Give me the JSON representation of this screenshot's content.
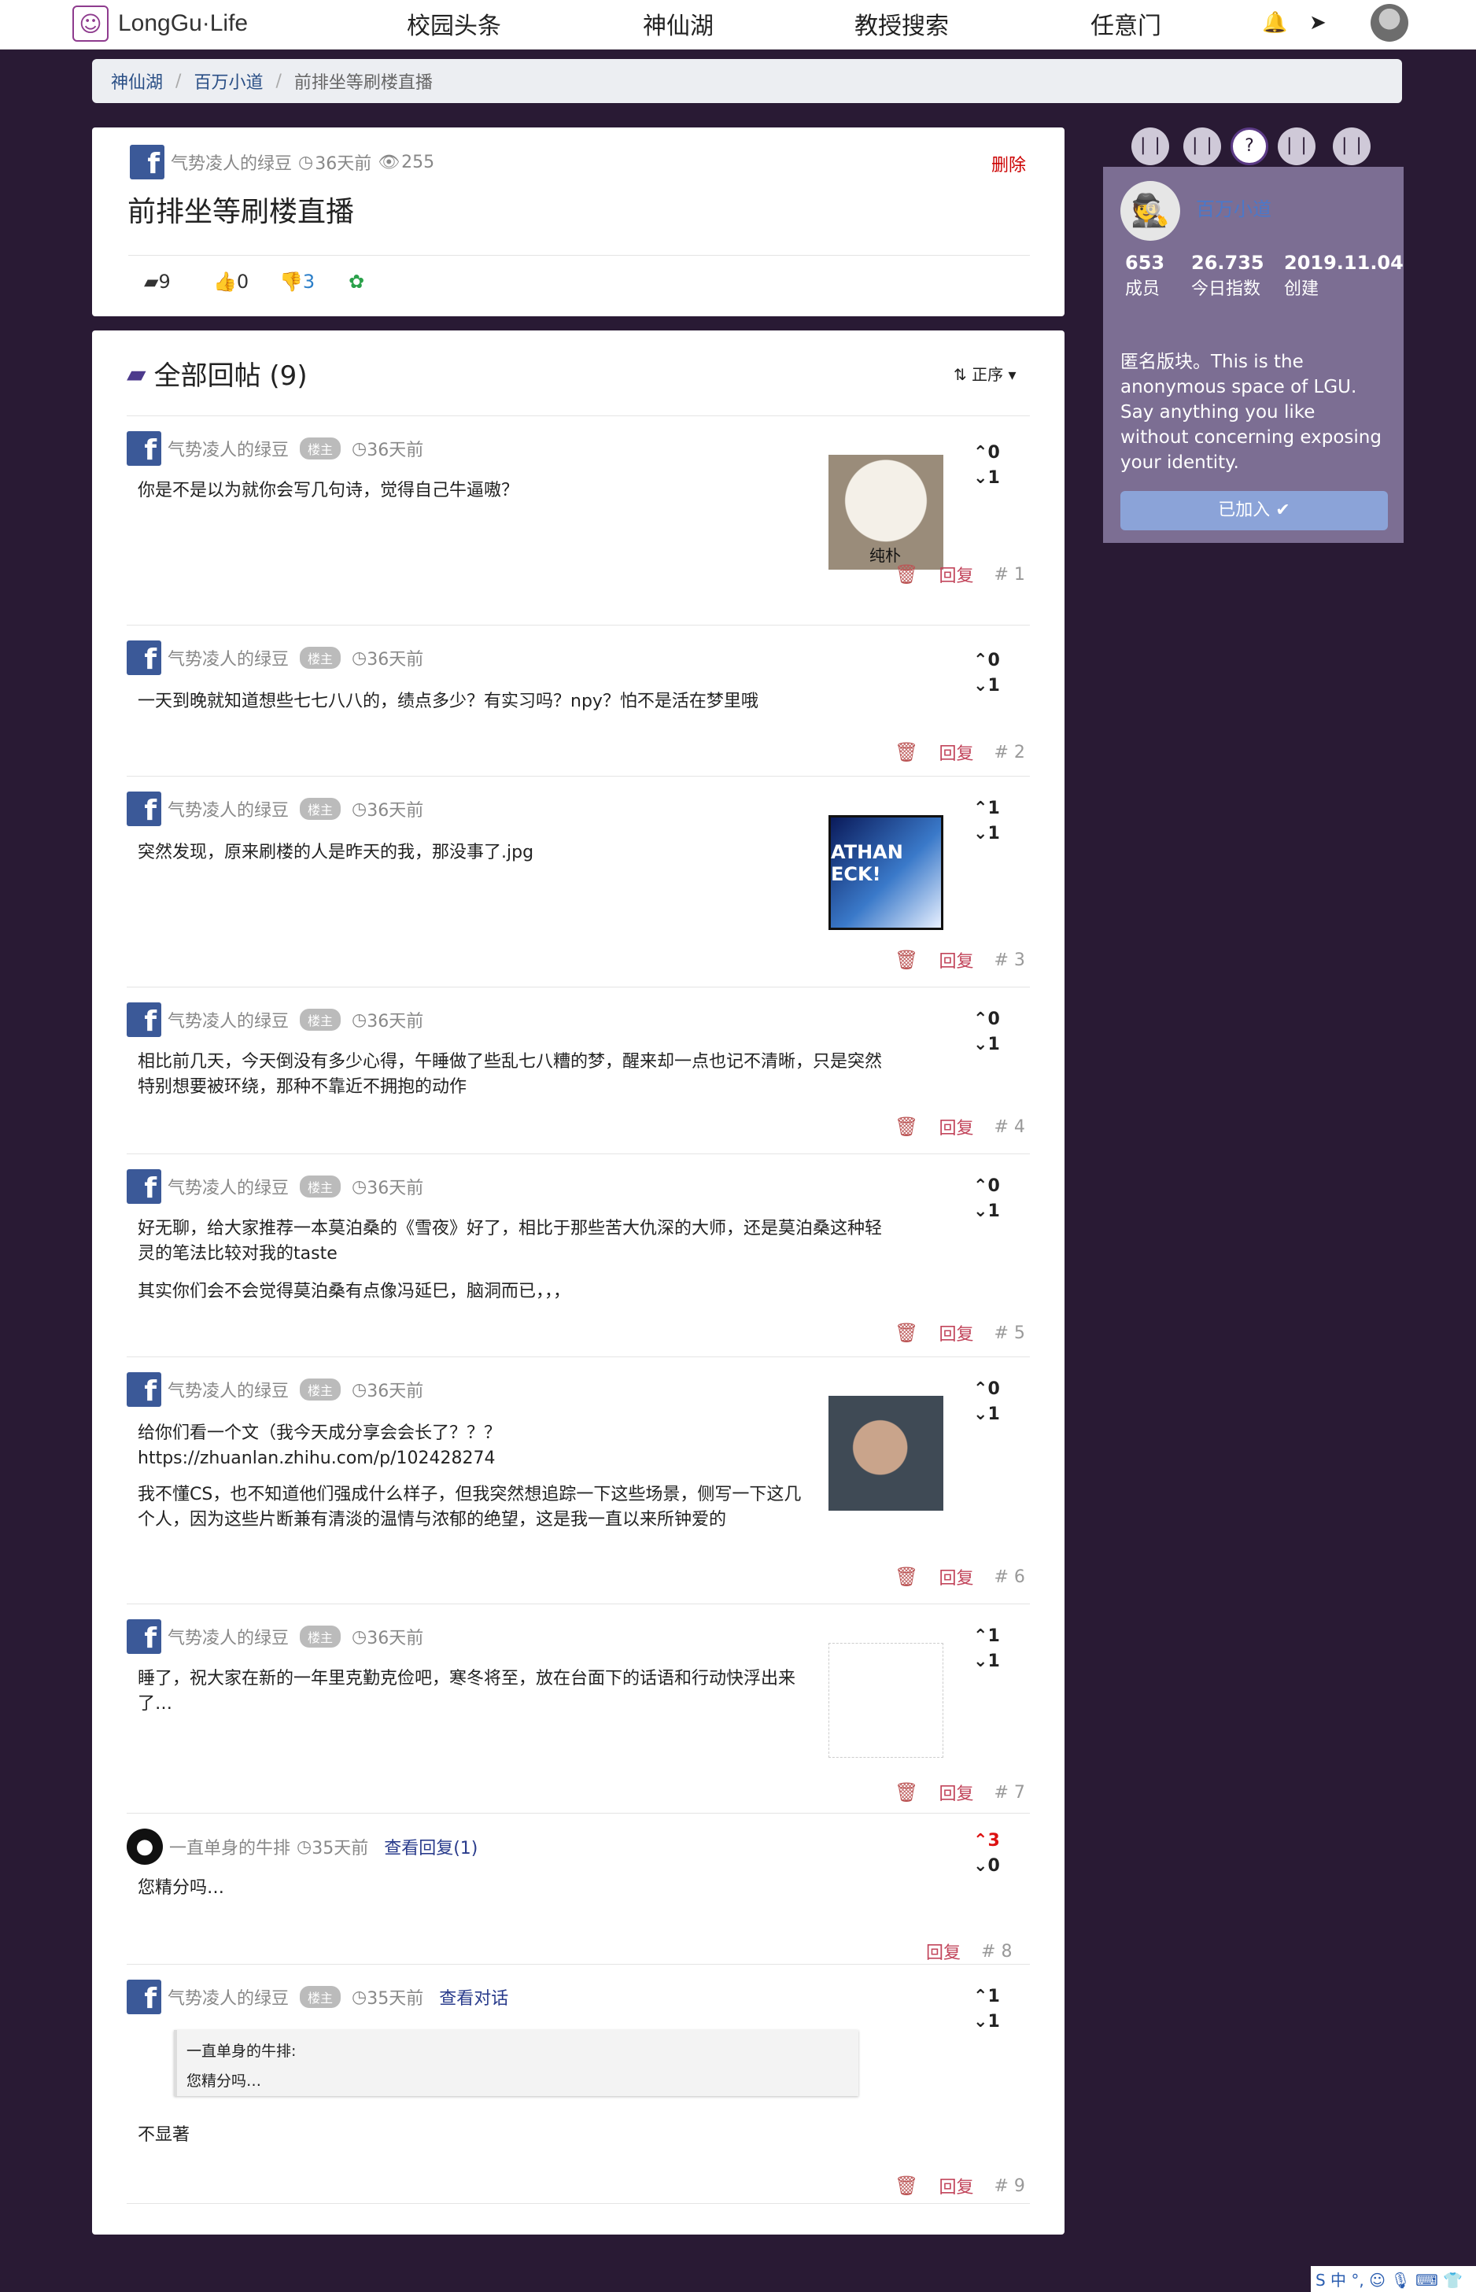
{
  "nav": {
    "brand": "LongGu·Life",
    "links": [
      "校园头条",
      "神仙湖",
      "教授搜索",
      "任意门"
    ]
  },
  "breadcrumb": [
    "神仙湖",
    "百万小道",
    "前排坐等刷楼直播"
  ],
  "post": {
    "author": "气势凌人的绿豆",
    "time": "36天前",
    "views": "255",
    "delete": "删除",
    "title": "前排坐等刷楼直播",
    "comments": "9",
    "likes": "0",
    "dislikes": "3"
  },
  "replies_header": {
    "title": "全部回帖 (9)",
    "sort": "正序"
  },
  "replies": [
    {
      "author": "气势凌人的绿豆",
      "badge": "楼主",
      "time": "36天前",
      "text": "你是不是以为就你会写几句诗，觉得自己牛逼嗷？",
      "up": "0",
      "down": "1",
      "reply": "回复",
      "floor": "# 1",
      "thumb_caption": "纯朴"
    },
    {
      "author": "气势凌人的绿豆",
      "badge": "楼主",
      "time": "36天前",
      "text": "一天到晚就知道想些七七八八的，绩点多少？有实习吗？npy？怕不是活在梦里哦",
      "up": "0",
      "down": "1",
      "reply": "回复",
      "floor": "# 2"
    },
    {
      "author": "气势凌人的绿豆",
      "badge": "楼主",
      "time": "36天前",
      "text": "突然发现，原来刷楼的人是昨天的我，那没事了.jpg",
      "up": "1",
      "down": "1",
      "reply": "回复",
      "floor": "# 3",
      "thumb_caption": "ATHAN ECK!"
    },
    {
      "author": "气势凌人的绿豆",
      "badge": "楼主",
      "time": "36天前",
      "text": "相比前几天，今天倒没有多少心得，午睡做了些乱七八糟的梦，醒来却一点也记不清晰，只是突然特别想要被环绕，那种不靠近不拥抱的动作",
      "up": "0",
      "down": "1",
      "reply": "回复",
      "floor": "# 4"
    },
    {
      "author": "气势凌人的绿豆",
      "badge": "楼主",
      "time": "36天前",
      "text": "好无聊，给大家推荐一本莫泊桑的《雪夜》好了，相比于那些苦大仇深的大师，还是莫泊桑这种轻灵的笔法比较对我的taste",
      "text2": "其实你们会不会觉得莫泊桑有点像冯延巳，脑洞而已，，，",
      "up": "0",
      "down": "1",
      "reply": "回复",
      "floor": "# 5"
    },
    {
      "author": "气势凌人的绿豆",
      "badge": "楼主",
      "time": "36天前",
      "text": "给你们看一个文（我今天成分享会会长了？？？https://zhuanlan.zhihu.com/p/102428274",
      "text2": "我不懂CS，也不知道他们强成什么样子，但我突然想追踪一下这些场景，侧写一下这几个人，因为这些片断兼有清淡的温情与浓郁的绝望，这是我一直以来所钟爱的",
      "up": "0",
      "down": "1",
      "reply": "回复",
      "floor": "# 6"
    },
    {
      "author": "气势凌人的绿豆",
      "badge": "楼主",
      "time": "36天前",
      "text": "睡了，祝大家在新的一年里克勤克俭吧，寒冬将至，放在台面下的话语和行动快浮出来了…",
      "up": "1",
      "down": "1",
      "reply": "回复",
      "floor": "# 7"
    },
    {
      "author": "一直单身的牛排",
      "time": "35天前",
      "view_replies": "查看回复(1)",
      "text": "您精分吗…",
      "up": "3",
      "down": "0",
      "reply": "回复",
      "floor": "# 8"
    },
    {
      "author": "气势凌人的绿豆",
      "badge": "楼主",
      "time": "35天前",
      "view_dialog": "查看对话",
      "quote_author": "一直单身的牛排:",
      "quote_text": "您精分吗…",
      "text": "不显著",
      "up": "1",
      "down": "1",
      "reply": "回复",
      "floor": "# 9"
    }
  ],
  "side": {
    "name": "百万小道",
    "stats": [
      {
        "value": "653",
        "label": "成员"
      },
      {
        "value": "26.735",
        "label": "今日指数"
      },
      {
        "value": "2019.11.04",
        "label": "创建"
      }
    ],
    "description": "匿名版块。This is the anonymous space of LGU. Say anything you like without concerning exposing your identity.",
    "joined": "已加入 ✔"
  },
  "ime": "S 中 °, ☺ 🎙 ⌨ 👕"
}
